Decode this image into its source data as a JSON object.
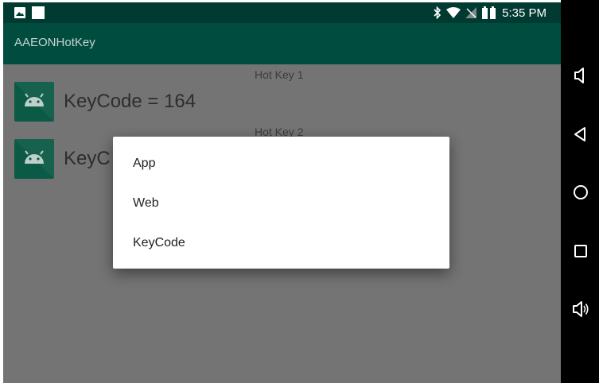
{
  "status_bar": {
    "time": "5:35 PM",
    "icons": [
      "image-icon",
      "square-notification-icon",
      "bluetooth-icon",
      "wifi-icon",
      "no-signal-icon",
      "battery-icon"
    ]
  },
  "app_bar": {
    "title": "AAEONHotKey"
  },
  "hotkeys": [
    {
      "label": "Hot Key 1",
      "value": "KeyCode = 164"
    },
    {
      "label": "Hot Key 2",
      "value": "KeyC"
    }
  ],
  "dialog": {
    "items": [
      "App",
      "Web",
      "KeyCode"
    ]
  },
  "nav_bar": {
    "buttons": [
      "volume-down-icon",
      "back-icon",
      "home-icon",
      "recents-icon",
      "volume-up-icon"
    ]
  },
  "colors": {
    "status_bar": "#003a31",
    "app_bar": "#004d40",
    "app_icon": "#0b5a45",
    "content_dimmed": "#747474"
  }
}
